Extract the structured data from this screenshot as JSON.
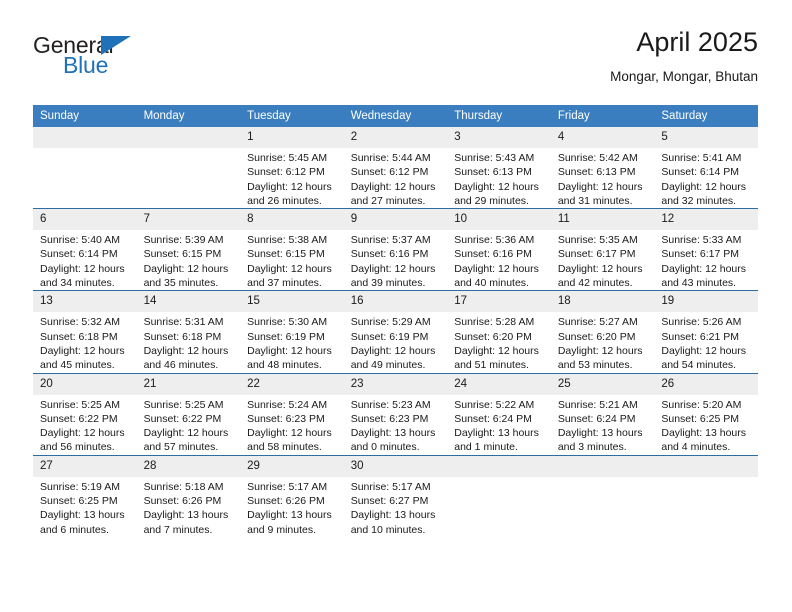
{
  "brand": {
    "name_part1": "General",
    "name_part2": "Blue"
  },
  "header": {
    "month_title": "April 2025",
    "location": "Mongar, Mongar, Bhutan"
  },
  "colors": {
    "header_blue": "#3b7ebf",
    "row_divider_blue": "#2e6da4",
    "daynum_band": "#eeeeee",
    "brand_blue": "#1f72b8"
  },
  "weekday_headers": [
    "Sunday",
    "Monday",
    "Tuesday",
    "Wednesday",
    "Thursday",
    "Friday",
    "Saturday"
  ],
  "weeks": [
    [
      {
        "day": "",
        "blank": true,
        "sunrise": "",
        "sunset": "",
        "daylight1": "",
        "daylight2": ""
      },
      {
        "day": "",
        "blank": true,
        "sunrise": "",
        "sunset": "",
        "daylight1": "",
        "daylight2": ""
      },
      {
        "day": "1",
        "sunrise": "Sunrise: 5:45 AM",
        "sunset": "Sunset: 6:12 PM",
        "daylight1": "Daylight: 12 hours",
        "daylight2": "and 26 minutes."
      },
      {
        "day": "2",
        "sunrise": "Sunrise: 5:44 AM",
        "sunset": "Sunset: 6:12 PM",
        "daylight1": "Daylight: 12 hours",
        "daylight2": "and 27 minutes."
      },
      {
        "day": "3",
        "sunrise": "Sunrise: 5:43 AM",
        "sunset": "Sunset: 6:13 PM",
        "daylight1": "Daylight: 12 hours",
        "daylight2": "and 29 minutes."
      },
      {
        "day": "4",
        "sunrise": "Sunrise: 5:42 AM",
        "sunset": "Sunset: 6:13 PM",
        "daylight1": "Daylight: 12 hours",
        "daylight2": "and 31 minutes."
      },
      {
        "day": "5",
        "sunrise": "Sunrise: 5:41 AM",
        "sunset": "Sunset: 6:14 PM",
        "daylight1": "Daylight: 12 hours",
        "daylight2": "and 32 minutes."
      }
    ],
    [
      {
        "day": "6",
        "sunrise": "Sunrise: 5:40 AM",
        "sunset": "Sunset: 6:14 PM",
        "daylight1": "Daylight: 12 hours",
        "daylight2": "and 34 minutes."
      },
      {
        "day": "7",
        "sunrise": "Sunrise: 5:39 AM",
        "sunset": "Sunset: 6:15 PM",
        "daylight1": "Daylight: 12 hours",
        "daylight2": "and 35 minutes."
      },
      {
        "day": "8",
        "sunrise": "Sunrise: 5:38 AM",
        "sunset": "Sunset: 6:15 PM",
        "daylight1": "Daylight: 12 hours",
        "daylight2": "and 37 minutes."
      },
      {
        "day": "9",
        "sunrise": "Sunrise: 5:37 AM",
        "sunset": "Sunset: 6:16 PM",
        "daylight1": "Daylight: 12 hours",
        "daylight2": "and 39 minutes."
      },
      {
        "day": "10",
        "sunrise": "Sunrise: 5:36 AM",
        "sunset": "Sunset: 6:16 PM",
        "daylight1": "Daylight: 12 hours",
        "daylight2": "and 40 minutes."
      },
      {
        "day": "11",
        "sunrise": "Sunrise: 5:35 AM",
        "sunset": "Sunset: 6:17 PM",
        "daylight1": "Daylight: 12 hours",
        "daylight2": "and 42 minutes."
      },
      {
        "day": "12",
        "sunrise": "Sunrise: 5:33 AM",
        "sunset": "Sunset: 6:17 PM",
        "daylight1": "Daylight: 12 hours",
        "daylight2": "and 43 minutes."
      }
    ],
    [
      {
        "day": "13",
        "sunrise": "Sunrise: 5:32 AM",
        "sunset": "Sunset: 6:18 PM",
        "daylight1": "Daylight: 12 hours",
        "daylight2": "and 45 minutes."
      },
      {
        "day": "14",
        "sunrise": "Sunrise: 5:31 AM",
        "sunset": "Sunset: 6:18 PM",
        "daylight1": "Daylight: 12 hours",
        "daylight2": "and 46 minutes."
      },
      {
        "day": "15",
        "sunrise": "Sunrise: 5:30 AM",
        "sunset": "Sunset: 6:19 PM",
        "daylight1": "Daylight: 12 hours",
        "daylight2": "and 48 minutes."
      },
      {
        "day": "16",
        "sunrise": "Sunrise: 5:29 AM",
        "sunset": "Sunset: 6:19 PM",
        "daylight1": "Daylight: 12 hours",
        "daylight2": "and 49 minutes."
      },
      {
        "day": "17",
        "sunrise": "Sunrise: 5:28 AM",
        "sunset": "Sunset: 6:20 PM",
        "daylight1": "Daylight: 12 hours",
        "daylight2": "and 51 minutes."
      },
      {
        "day": "18",
        "sunrise": "Sunrise: 5:27 AM",
        "sunset": "Sunset: 6:20 PM",
        "daylight1": "Daylight: 12 hours",
        "daylight2": "and 53 minutes."
      },
      {
        "day": "19",
        "sunrise": "Sunrise: 5:26 AM",
        "sunset": "Sunset: 6:21 PM",
        "daylight1": "Daylight: 12 hours",
        "daylight2": "and 54 minutes."
      }
    ],
    [
      {
        "day": "20",
        "sunrise": "Sunrise: 5:25 AM",
        "sunset": "Sunset: 6:22 PM",
        "daylight1": "Daylight: 12 hours",
        "daylight2": "and 56 minutes."
      },
      {
        "day": "21",
        "sunrise": "Sunrise: 5:25 AM",
        "sunset": "Sunset: 6:22 PM",
        "daylight1": "Daylight: 12 hours",
        "daylight2": "and 57 minutes."
      },
      {
        "day": "22",
        "sunrise": "Sunrise: 5:24 AM",
        "sunset": "Sunset: 6:23 PM",
        "daylight1": "Daylight: 12 hours",
        "daylight2": "and 58 minutes."
      },
      {
        "day": "23",
        "sunrise": "Sunrise: 5:23 AM",
        "sunset": "Sunset: 6:23 PM",
        "daylight1": "Daylight: 13 hours",
        "daylight2": "and 0 minutes."
      },
      {
        "day": "24",
        "sunrise": "Sunrise: 5:22 AM",
        "sunset": "Sunset: 6:24 PM",
        "daylight1": "Daylight: 13 hours",
        "daylight2": "and 1 minute."
      },
      {
        "day": "25",
        "sunrise": "Sunrise: 5:21 AM",
        "sunset": "Sunset: 6:24 PM",
        "daylight1": "Daylight: 13 hours",
        "daylight2": "and 3 minutes."
      },
      {
        "day": "26",
        "sunrise": "Sunrise: 5:20 AM",
        "sunset": "Sunset: 6:25 PM",
        "daylight1": "Daylight: 13 hours",
        "daylight2": "and 4 minutes."
      }
    ],
    [
      {
        "day": "27",
        "sunrise": "Sunrise: 5:19 AM",
        "sunset": "Sunset: 6:25 PM",
        "daylight1": "Daylight: 13 hours",
        "daylight2": "and 6 minutes."
      },
      {
        "day": "28",
        "sunrise": "Sunrise: 5:18 AM",
        "sunset": "Sunset: 6:26 PM",
        "daylight1": "Daylight: 13 hours",
        "daylight2": "and 7 minutes."
      },
      {
        "day": "29",
        "sunrise": "Sunrise: 5:17 AM",
        "sunset": "Sunset: 6:26 PM",
        "daylight1": "Daylight: 13 hours",
        "daylight2": "and 9 minutes."
      },
      {
        "day": "30",
        "sunrise": "Sunrise: 5:17 AM",
        "sunset": "Sunset: 6:27 PM",
        "daylight1": "Daylight: 13 hours",
        "daylight2": "and 10 minutes."
      },
      {
        "day": "",
        "blank": true,
        "sunrise": "",
        "sunset": "",
        "daylight1": "",
        "daylight2": ""
      },
      {
        "day": "",
        "blank": true,
        "sunrise": "",
        "sunset": "",
        "daylight1": "",
        "daylight2": ""
      },
      {
        "day": "",
        "blank": true,
        "sunrise": "",
        "sunset": "",
        "daylight1": "",
        "daylight2": ""
      }
    ]
  ]
}
